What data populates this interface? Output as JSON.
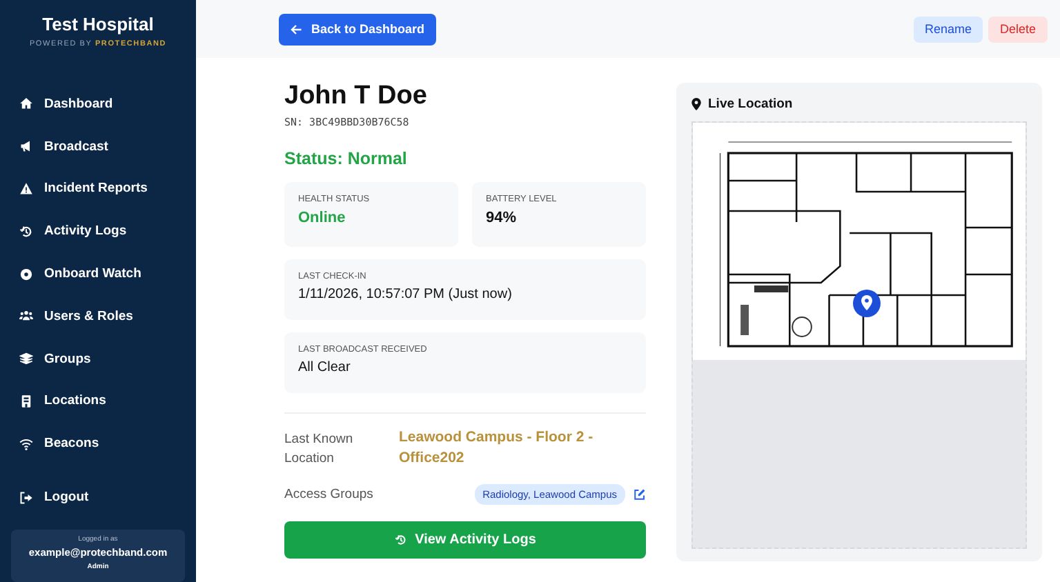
{
  "sidebar": {
    "title": "Test Hospital",
    "powered_by": "POWERED BY",
    "brand": "PROTECHBAND",
    "items": [
      {
        "label": "Dashboard"
      },
      {
        "label": "Broadcast"
      },
      {
        "label": "Incident Reports"
      },
      {
        "label": "Activity Logs"
      },
      {
        "label": "Onboard Watch"
      },
      {
        "label": "Users & Roles"
      },
      {
        "label": "Groups"
      },
      {
        "label": "Locations"
      },
      {
        "label": "Beacons"
      }
    ],
    "logout": "Logout",
    "user": {
      "caption": "Logged in as",
      "email": "example@protechband.com",
      "role": "Admin"
    }
  },
  "toolbar": {
    "back": "Back to Dashboard",
    "rename": "Rename",
    "delete": "Delete"
  },
  "person": {
    "name": "John T Doe",
    "serial": "SN: 3BC49BBD30B76C58",
    "status": "Status: Normal"
  },
  "stats": [
    {
      "label": "HEALTH STATUS",
      "value": "Online",
      "kind": "status"
    },
    {
      "label": "BATTERY LEVEL",
      "value": "94%",
      "kind": "plain"
    }
  ],
  "cards": [
    {
      "label": "LAST CHECK-IN",
      "value": "1/11/2026, 10:57:07 PM (Just now)"
    },
    {
      "label": "LAST BROADCAST RECEIVED",
      "value": "All Clear"
    }
  ],
  "location": {
    "label": "Last Known Location",
    "value": "Leawood Campus - Floor 2 - Office202"
  },
  "access": {
    "label": "Access Groups",
    "tag": "Radiology, Leawood Campus"
  },
  "activity_button": "View Activity Logs",
  "live_location": {
    "title": "Live Location"
  }
}
